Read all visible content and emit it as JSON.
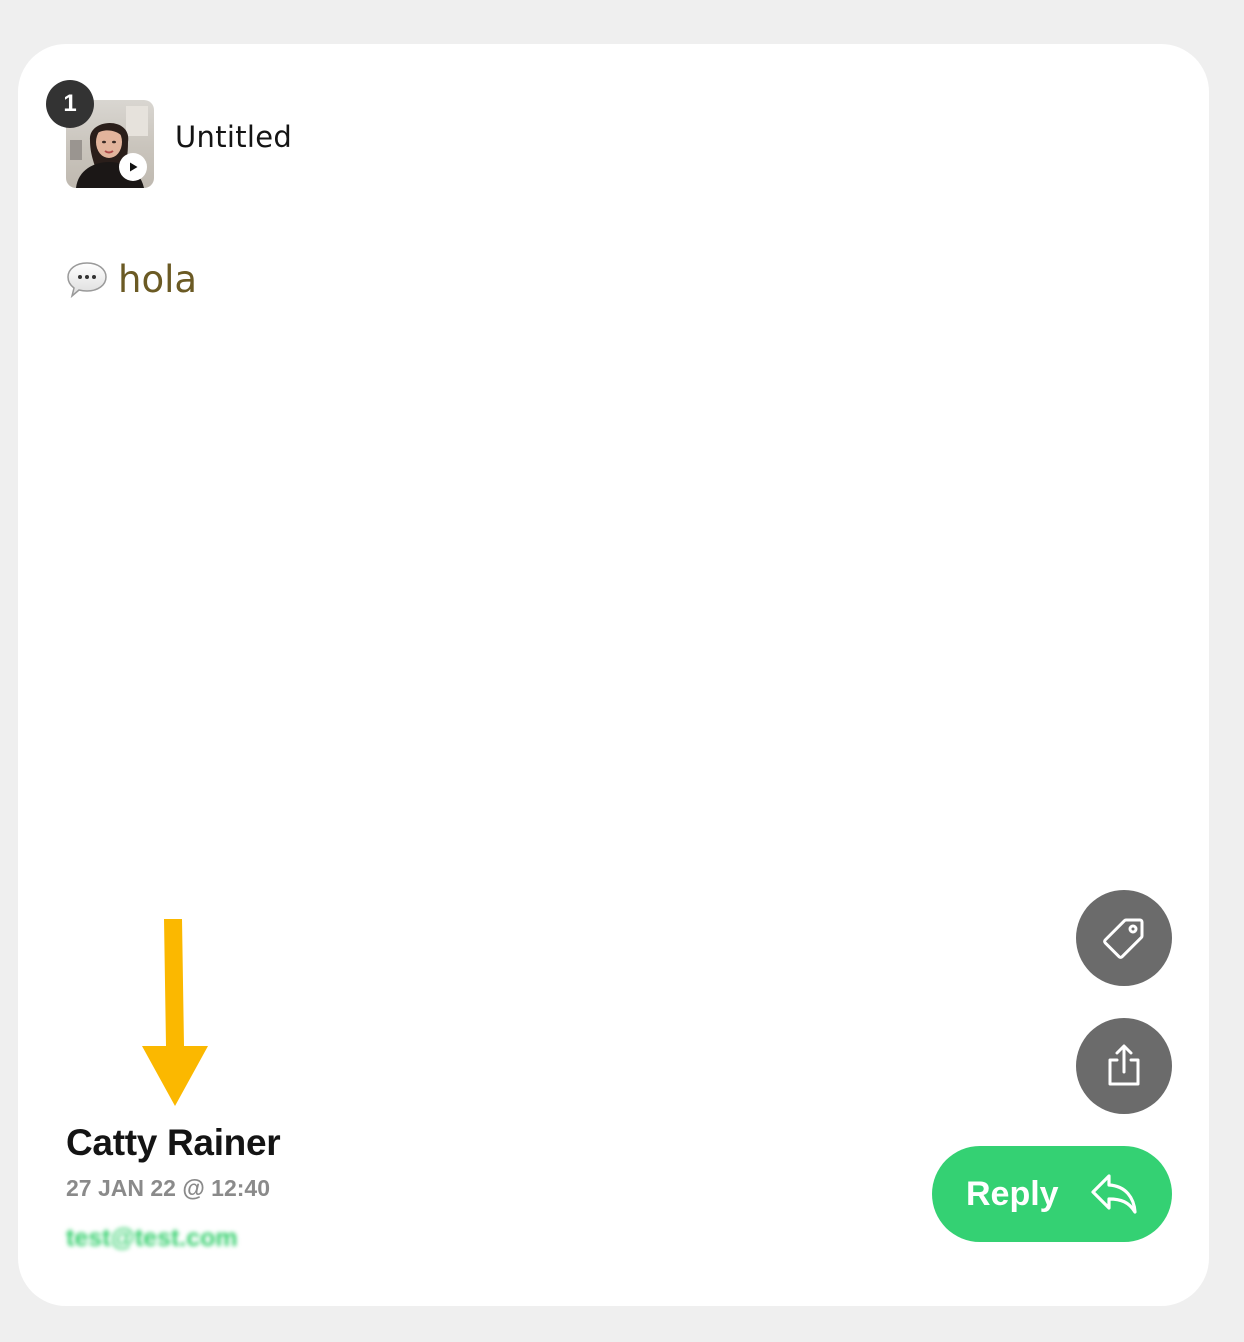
{
  "item": {
    "badge_count": "1",
    "title": "Untitled",
    "thumbnail_icon": "play-icon"
  },
  "message": {
    "icon": "speech-bubble-icon",
    "text": "hola"
  },
  "sender": {
    "name": "Catty Rainer",
    "date": "27 JAN 22 @ 12:40",
    "email": "test@test.com"
  },
  "actions": {
    "tag_icon": "tag-icon",
    "share_icon": "share-icon",
    "reply_label": "Reply",
    "reply_icon": "reply-arrow-icon"
  },
  "annotation": {
    "arrow_icon": "down-arrow-icon"
  },
  "colors": {
    "reply_green": "#34d173",
    "action_gray": "#6b6b6b",
    "message_text": "#6b5a24",
    "email_green": "#33cf6c",
    "annotation_arrow": "#fbb800"
  }
}
